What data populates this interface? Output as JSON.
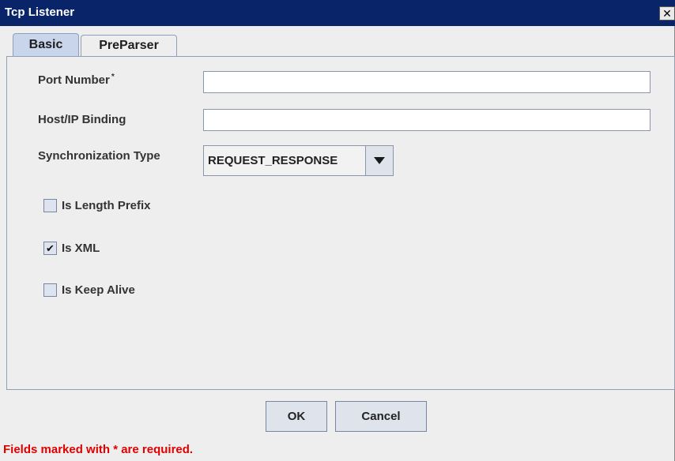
{
  "window": {
    "title": "Tcp Listener",
    "close_glyph": "✕"
  },
  "tabs": [
    {
      "label": "Basic",
      "selected": true
    },
    {
      "label": "PreParser",
      "selected": false
    }
  ],
  "form": {
    "port_number": {
      "label": "Port Number",
      "required_mark": "*",
      "value": ""
    },
    "host_binding": {
      "label": "Host/IP Binding",
      "value": ""
    },
    "sync_type": {
      "label": "Synchronization Type",
      "selected": "REQUEST_RESPONSE"
    },
    "checkboxes": [
      {
        "label": "Is Length Prefix",
        "checked": false,
        "mark": ""
      },
      {
        "label": "Is XML",
        "checked": true,
        "mark": "✔"
      },
      {
        "label": "Is Keep Alive",
        "checked": false,
        "mark": ""
      }
    ]
  },
  "buttons": {
    "ok": "OK",
    "cancel": "Cancel"
  },
  "footer": {
    "note": "Fields marked with * are required."
  },
  "colors": {
    "titlebar": "#0a246a",
    "required_note": "#e00000",
    "selected_tab": "#c8d5ea"
  }
}
